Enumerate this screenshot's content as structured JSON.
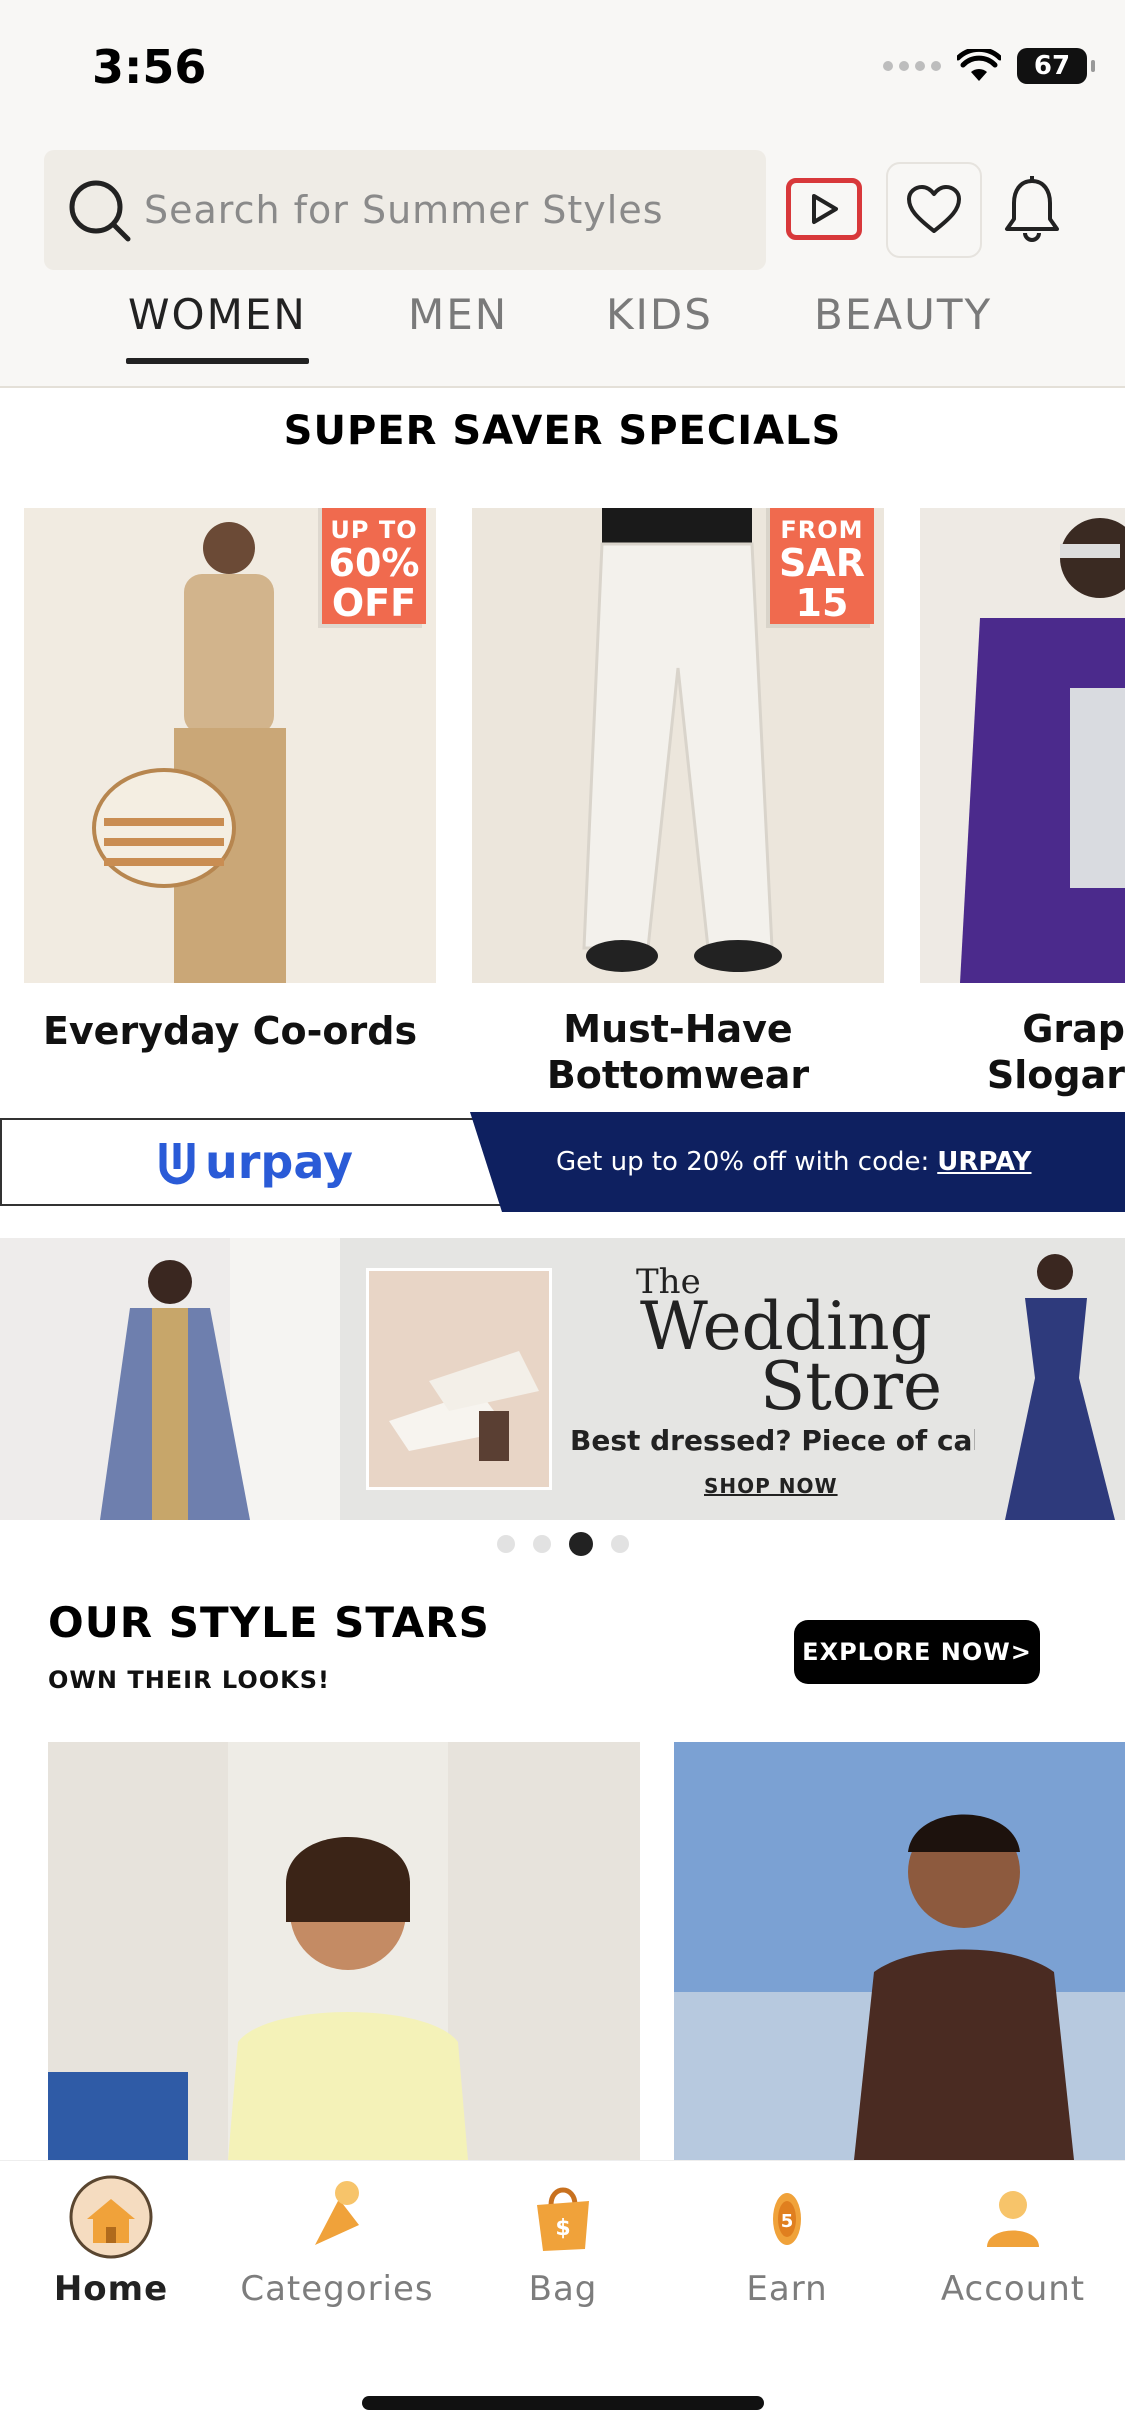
{
  "status_bar": {
    "time": "3:56",
    "battery": "67"
  },
  "header": {
    "search_placeholder": "Search for Summer Styles",
    "tabs": [
      {
        "label": "WOMEN",
        "active": true
      },
      {
        "label": "MEN",
        "active": false
      },
      {
        "label": "KIDS",
        "active": false
      },
      {
        "label": "BEAUTY",
        "active": false
      }
    ]
  },
  "specials": {
    "title": "SUPER SAVER SPECIALS",
    "cards": [
      {
        "label": "Everyday Co-ords",
        "badge_line1": "UP TO",
        "badge_line2": "60%",
        "badge_line3": "OFF"
      },
      {
        "label_line1": "Must-Have",
        "label_line2": "Bottomwear",
        "badge_line1": "FROM",
        "badge_line2": "SAR",
        "badge_line3": "15"
      },
      {
        "label_line1": "Grap",
        "label_line2": "Slogar"
      }
    ]
  },
  "urpay": {
    "logo_text": "urpay",
    "promo_text": "Get up to 20% off with code:",
    "promo_code": "URPAY"
  },
  "wedding_banner": {
    "title_line1": "The",
    "title_line2": "Wedding",
    "title_line3": "Store",
    "subtitle": "Best dressed? Piece of cake.",
    "cta": "SHOP NOW"
  },
  "carousel": {
    "total": 4,
    "active_index": 2
  },
  "style_stars": {
    "title": "OUR STYLE STARS",
    "subtitle": "OWN THEIR LOOKS!",
    "cta": "EXPLORE NOW>"
  },
  "tab_bar": {
    "items": [
      {
        "label": "Home",
        "icon": "home-icon",
        "active": true
      },
      {
        "label": "Categories",
        "icon": "categories-icon",
        "active": false
      },
      {
        "label": "Bag",
        "icon": "bag-icon",
        "active": false
      },
      {
        "label": "Earn",
        "icon": "coin-icon",
        "active": false
      },
      {
        "label": "Account",
        "icon": "account-icon",
        "active": false
      }
    ]
  },
  "colors": {
    "accent_red": "#d8383a",
    "badge_orange": "#f06a4e",
    "urpay_blue": "#2a5bd7",
    "urpay_navy": "#0e2060",
    "tab_icon_orange": "#f0a23a"
  }
}
